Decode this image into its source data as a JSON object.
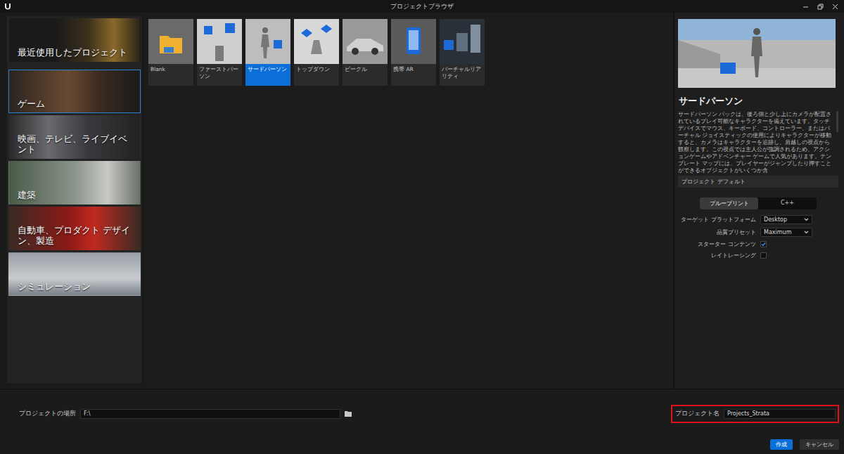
{
  "window": {
    "title": "プロジェクトブラウザ"
  },
  "categories": [
    {
      "label": "最近使用したプロジェクト",
      "selected": false
    },
    {
      "label": "ゲーム",
      "selected": true
    },
    {
      "label": "映画、テレビ、ライブイベント",
      "selected": false
    },
    {
      "label": "建築",
      "selected": false
    },
    {
      "label": "自動車、プロダクト デザイン、製造",
      "selected": false
    },
    {
      "label": "シミュレーション",
      "selected": false
    }
  ],
  "templates": [
    {
      "label": "Blank",
      "selected": false
    },
    {
      "label": "ファーストパーソン",
      "selected": false
    },
    {
      "label": "サードパーソン",
      "selected": true
    },
    {
      "label": "トップダウン",
      "selected": false
    },
    {
      "label": "ビークル",
      "selected": false
    },
    {
      "label": "携帯 AR",
      "selected": false
    },
    {
      "label": "バーチャルリアリティ",
      "selected": false
    }
  ],
  "details": {
    "title": "サードパーソン",
    "description": "サードパーソン パックは、後ろ側と少し上にカメラが配置されているプレイ可能なキャラクターを備えています。タッチデバイスでマウス、キーボード、コントローラー、またはバーチャル ジョイスティックの使用によりキャラクターが移動すると、カメラはキャラクターを追跡し、肩越しの視点から観察します。この視点では主人公が強調されるため、アクションゲームやアドベンチャー ゲームで人気があります。テンプレート マップには、プレイヤーがジャンプしたり押すことができるオブジェクトがいくつか含",
    "section": "プロジェクト デフォルト",
    "languages": [
      {
        "label": "ブループリント",
        "selected": true
      },
      {
        "label": "C++",
        "selected": false
      }
    ],
    "settings": [
      {
        "label": "ターゲット プラットフォーム",
        "kind": "dropdown",
        "value": "Desktop"
      },
      {
        "label": "品質プリセット",
        "kind": "dropdown",
        "value": "Maximum"
      },
      {
        "label": "スターター コンテンツ",
        "kind": "checkbox",
        "checked": true
      },
      {
        "label": "レイトレーシング",
        "kind": "checkbox",
        "checked": false
      }
    ]
  },
  "location": {
    "label": "プロジェクトの場所",
    "value": "F:\\"
  },
  "project_name": {
    "label": "プロジェクト名",
    "value": "Projects_Strata",
    "highlighted": true
  },
  "buttons": [
    {
      "label": "作成",
      "primary": true
    },
    {
      "label": "キャンセル",
      "primary": false
    }
  ]
}
